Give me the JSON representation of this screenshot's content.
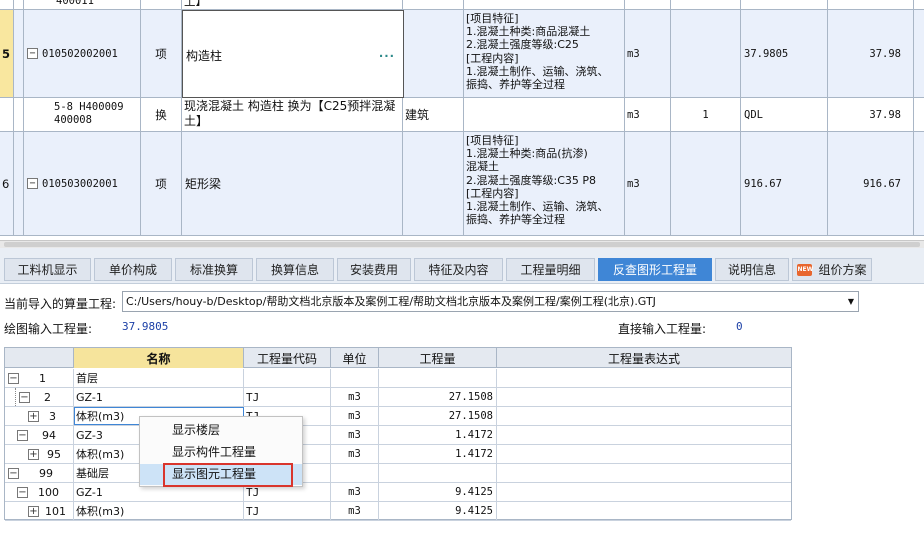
{
  "upper_grid": {
    "rows": [
      {
        "index": "",
        "code": "400011",
        "type": "",
        "name": "土】",
        "unit_type": "",
        "features": "",
        "unit": "",
        "qty": "",
        "expr": "",
        "amount": ""
      },
      {
        "index": "5",
        "code": "010502002001",
        "type": "项",
        "name": "构造柱",
        "unit_type": "",
        "features": "[项目特征]\n1.混凝土种类:商品混凝土\n2.混凝土强度等级:C25\n[工程内容]\n1.混凝土制作、运输、浇筑、\n振捣、养护等全过程",
        "unit": "m3",
        "qty": "",
        "expr": "37.9805",
        "amount": "37.98"
      },
      {
        "index": "",
        "code": "5-8 H400009\n400008",
        "type": "换",
        "name": "现浇混凝土 构造柱 换为【C25预拌混凝\n土】",
        "unit_type": "建筑",
        "features": "",
        "unit": "m3",
        "qty": "1",
        "expr": "QDL",
        "amount": "37.98"
      },
      {
        "index": "6",
        "code": "010503002001",
        "type": "项",
        "name": "矩形梁",
        "unit_type": "",
        "features": "[项目特征]\n1.混凝土种类:商品(抗渗)\n混凝土\n2.混凝土强度等级:C35 P8\n[工程内容]\n1.混凝土制作、运输、浇筑、\n振捣、养护等全过程",
        "unit": "m3",
        "qty": "",
        "expr": "916.67",
        "amount": "916.67"
      }
    ],
    "edit_dots": "···"
  },
  "tabs": [
    {
      "label": "工料机显示"
    },
    {
      "label": "单价构成"
    },
    {
      "label": "标准换算"
    },
    {
      "label": "换算信息"
    },
    {
      "label": "安装费用"
    },
    {
      "label": "特征及内容"
    },
    {
      "label": "工程量明细"
    },
    {
      "label": "反查图形工程量"
    },
    {
      "label": "说明信息"
    },
    {
      "label": "组价方案"
    }
  ],
  "new_badge": "NEW",
  "active_tab": "反查图形工程量",
  "path": {
    "label": "当前导入的算量工程:",
    "value": "C:/Users/houy-b/Desktop/帮助文档北京版本及案例工程/帮助文档北京版本及案例工程/案例工程(北京).GTJ"
  },
  "drawing_input": {
    "label": "绘图输入工程量:",
    "value": "37.9805"
  },
  "direct_input": {
    "label": "直接输入工程量:",
    "value": "0"
  },
  "lower_grid": {
    "headers": {
      "name": "名称",
      "code": "工程量代码",
      "unit": "单位",
      "qty": "工程量",
      "expr": "工程量表达式"
    },
    "rows": [
      {
        "num": "1",
        "name": "首层",
        "code": "",
        "unit": "",
        "qty": ""
      },
      {
        "num": "2",
        "name": "GZ-1",
        "code": "TJ",
        "unit": "m3",
        "qty": "27.1508"
      },
      {
        "num": "3",
        "name": "体积(m3)",
        "code": "TJ",
        "unit": "m3",
        "qty": "27.1508"
      },
      {
        "num": "94",
        "name": "GZ-3",
        "code": "TJ",
        "unit": "m3",
        "qty": "1.4172"
      },
      {
        "num": "95",
        "name": "体积(m3)",
        "code": "TJ",
        "unit": "m3",
        "qty": "1.4172"
      },
      {
        "num": "99",
        "name": "基础层",
        "code": "",
        "unit": "",
        "qty": ""
      },
      {
        "num": "100",
        "name": "GZ-1",
        "code": "TJ",
        "unit": "m3",
        "qty": "9.4125"
      },
      {
        "num": "101",
        "name": "体积(m3)",
        "code": "TJ",
        "unit": "m3",
        "qty": "9.4125"
      }
    ]
  },
  "context_menu": {
    "items": [
      {
        "label": "显示楼层"
      },
      {
        "label": "显示构件工程量"
      },
      {
        "label": "显示图元工程量"
      }
    ]
  },
  "colors": {
    "active_tab": "#3f86d6",
    "highlight_box": "#d9352c",
    "name_header": "#f6e49c",
    "value_text": "#1b3fa6"
  }
}
